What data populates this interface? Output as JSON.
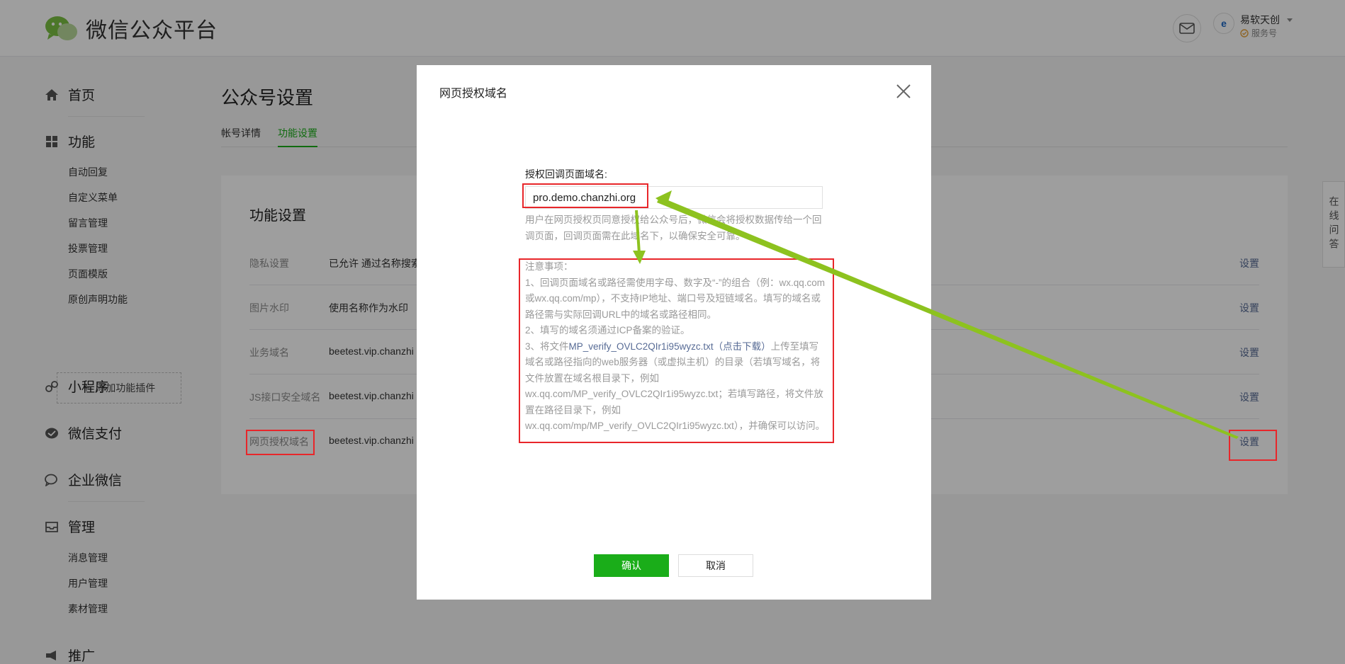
{
  "header": {
    "logo_text": "微信公众平台",
    "account_name": "易软天创",
    "account_type": "服务号",
    "account_avatar_text": "e"
  },
  "sidebar": {
    "home": "首页",
    "features": "功能",
    "features_items": [
      "自动回复",
      "自定义菜单",
      "留言管理",
      "投票管理",
      "页面模版",
      "原创声明功能"
    ],
    "add_plugin": "添加功能插件",
    "miniprogram": "小程序",
    "wechat_pay": "微信支付",
    "work_wechat": "企业微信",
    "manage": "管理",
    "manage_items": [
      "消息管理",
      "用户管理",
      "素材管理"
    ],
    "promote": "推广"
  },
  "main": {
    "page_title": "公众号设置",
    "tabs": [
      "帐号详情",
      "功能设置"
    ],
    "card_title": "功能设置",
    "rows": [
      {
        "label": "隐私设置",
        "value": "已允许 通过名称搜索",
        "action": "设置"
      },
      {
        "label": "图片水印",
        "value": "使用名称作为水印",
        "action": "设置"
      },
      {
        "label": "业务域名",
        "value": "beetest.vip.chanzhi",
        "action": "设置"
      },
      {
        "label": "JS接口安全域名",
        "value": "beetest.vip.chanzhi",
        "action": "设置"
      },
      {
        "label": "网页授权域名",
        "value": "beetest.vip.chanzhi",
        "action": "设置"
      }
    ]
  },
  "online_qa": "在线问答",
  "modal": {
    "title": "网页授权域名",
    "field_label": "授权回调页面域名:",
    "field_value": "pro.demo.chanzhi.org",
    "hint": "用户在网页授权页同意授权给公众号后，微信会将授权数据传给一个回调页面，回调页面需在此域名下，以确保安全可靠。",
    "notes_title": "注意事项：",
    "note1": "1、回调页面域名或路径需使用字母、数字及“-”的组合（例：wx.qq.com或wx.qq.com/mp），不支持IP地址、端口号及短链域名。填写的域名或路径需与实际回调URL中的域名或路径相同。",
    "note2": "2、填写的域名须通过ICP备案的验证。",
    "note3_prefix": "3、将文件",
    "note3_file": "MP_verify_OVLC2QIr1i95wyzc.txt",
    "note3_download": "（点击下载）",
    "note3_rest": "上传至填写域名或路径指向的web服务器（或虚拟主机）的目录（若填写域名，将文件放置在域名根目录下，例如wx.qq.com/MP_verify_OVLC2QIr1i95wyzc.txt；若填写路径，将文件放置在路径目录下，例如wx.qq.com/mp/MP_verify_OVLC2QIr1i95wyzc.txt），并确保可以访问。",
    "confirm": "确认",
    "cancel": "取消"
  },
  "colors": {
    "accent_green": "#1aad19",
    "link_blue": "#576b95",
    "annotation_red": "#e8262a",
    "annotation_arrow": "#8dc21f"
  }
}
